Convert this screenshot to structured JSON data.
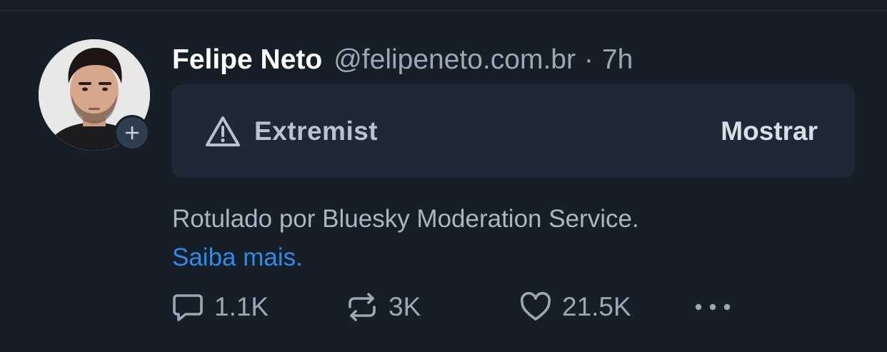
{
  "post": {
    "author": {
      "display_name": "Felipe Neto",
      "handle": "@felipeneto.com.br",
      "separator": "·",
      "time": "7h"
    },
    "label_card": {
      "icon": "warning-triangle-icon",
      "label": "Extremist",
      "show_label": "Mostrar"
    },
    "moderation_note": {
      "text": "Rotulado por Bluesky Moderation Service.",
      "link_text": "Saiba mais."
    },
    "actions": {
      "reply_count": "1.1K",
      "repost_count": "3K",
      "like_count": "21.5K"
    }
  },
  "colors": {
    "background": "#161e27",
    "card": "#1e2937",
    "muted_text": "#9aa8b7",
    "link": "#2f8be8"
  }
}
